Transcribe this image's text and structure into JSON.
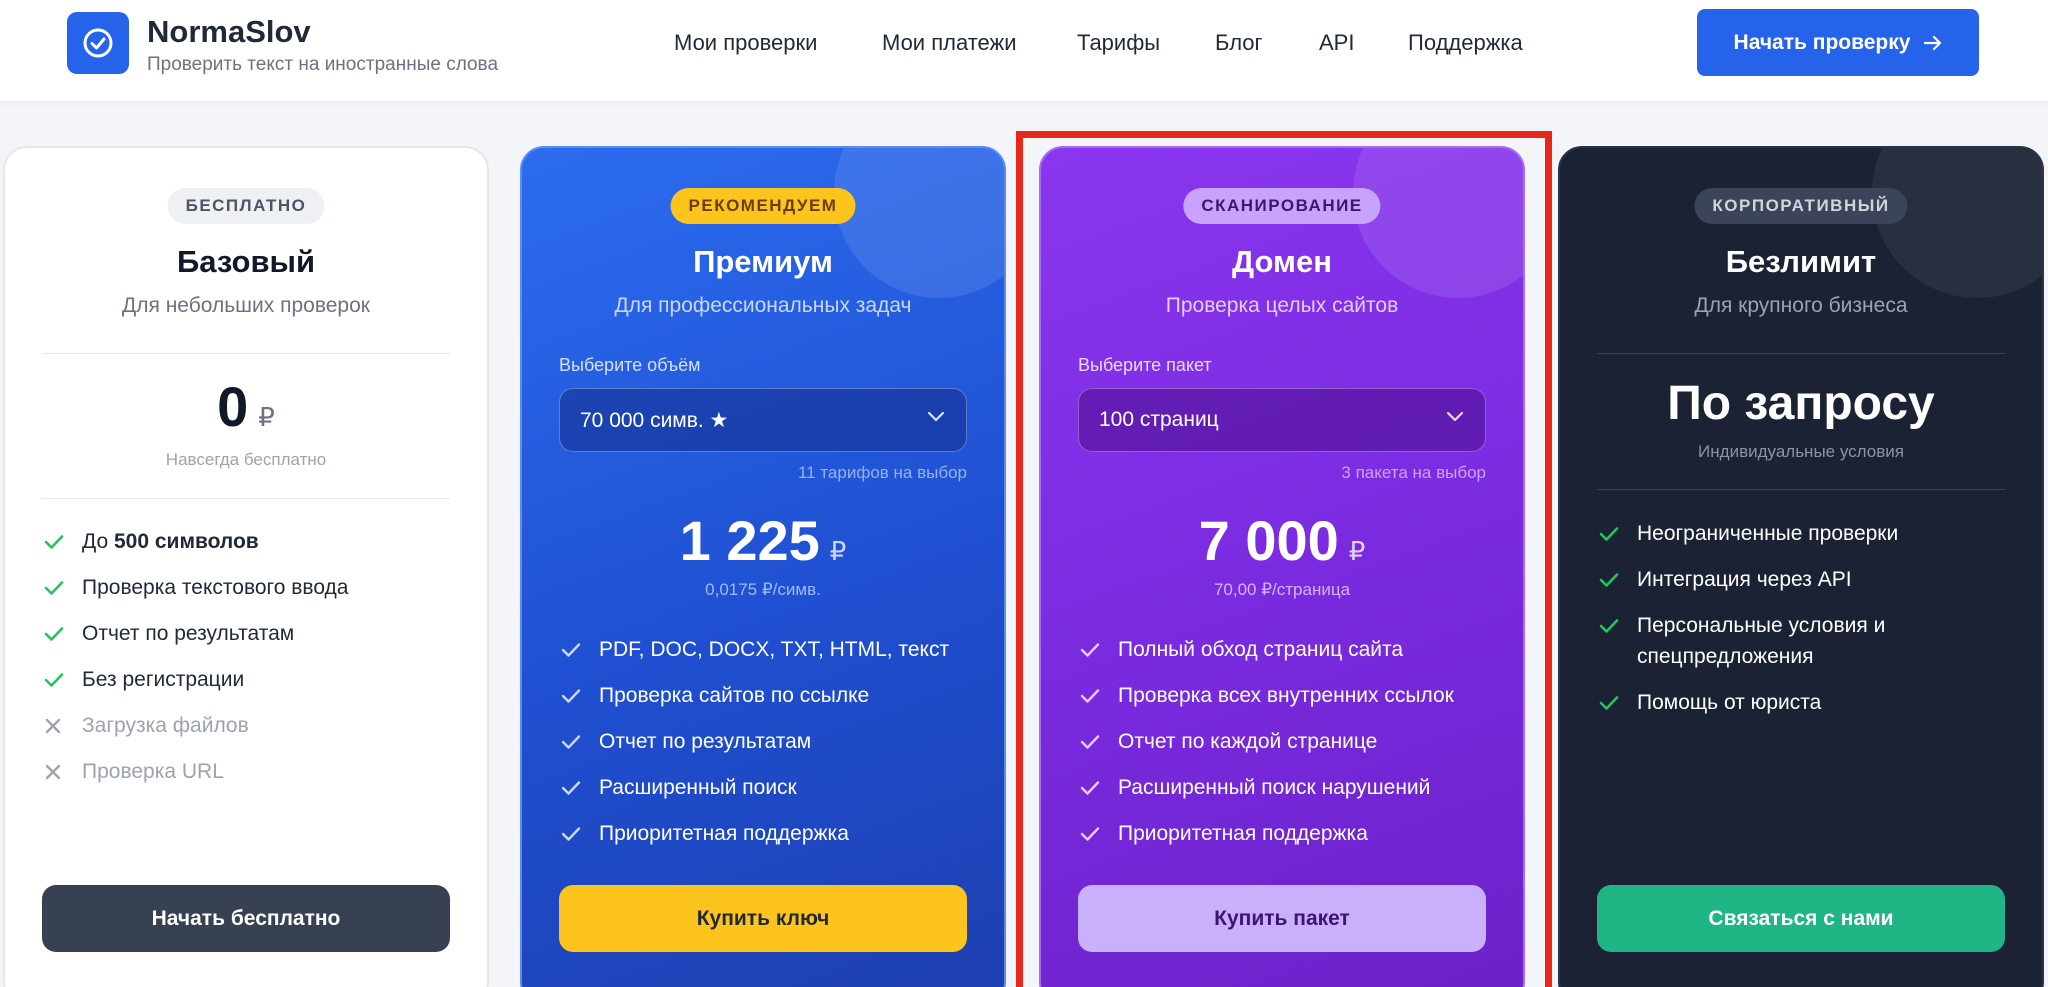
{
  "header": {
    "brand": "NormaSlov",
    "tagline": "Проверить текст на иностранные слова",
    "nav": [
      "Мои проверки",
      "Мои платежи",
      "Тарифы",
      "Блог",
      "API",
      "Поддержка"
    ],
    "cta_label": "Начать проверку"
  },
  "plans": {
    "basic": {
      "badge": "БЕСПЛАТНО",
      "title": "Базовый",
      "subtitle": "Для небольших проверок",
      "price": "0",
      "currency": "₽",
      "price_note": "Навсегда бесплатно",
      "features": [
        {
          "prefix": "До ",
          "bold": "500 символов",
          "enabled": true
        },
        {
          "text": "Проверка текстового ввода",
          "enabled": true
        },
        {
          "text": "Отчет по результатам",
          "enabled": true
        },
        {
          "text": "Без регистрации",
          "enabled": true
        },
        {
          "text": "Загрузка файлов",
          "enabled": false
        },
        {
          "text": "Проверка URL",
          "enabled": false
        }
      ],
      "button": "Начать бесплатно"
    },
    "premium": {
      "badge": "РЕКОМЕНДУЕМ",
      "title": "Премиум",
      "subtitle": "Для профессиональных задач",
      "select_label": "Выберите объём",
      "select_value": "70 000 симв. ★",
      "select_hint": "11 тарифов на выбор",
      "price": "1 225",
      "currency": "₽",
      "price_note": "0,0175 ₽/симв.",
      "features": [
        "PDF, DOC, DOCX, TXT, HTML, текст",
        "Проверка сайтов по ссылке",
        "Отчет по результатам",
        "Расширенный поиск",
        "Приоритетная поддержка"
      ],
      "button": "Купить ключ"
    },
    "domain": {
      "badge": "СКАНИРОВАНИЕ",
      "title": "Домен",
      "subtitle": "Проверка целых сайтов",
      "select_label": "Выберите пакет",
      "select_value": "100 страниц",
      "select_hint": "3 пакета на выбор",
      "price": "7 000",
      "currency": "₽",
      "price_note": "70,00 ₽/страница",
      "features": [
        "Полный обход страниц сайта",
        "Проверка всех внутренних ссылок",
        "Отчет по каждой странице",
        "Расширенный поиск нарушений",
        "Приоритетная поддержка"
      ],
      "button": "Купить пакет"
    },
    "unlimited": {
      "badge": "КОРПОРАТИВНЫЙ",
      "title": "Безлимит",
      "subtitle": "Для крупного бизнеса",
      "price": "По запросу",
      "price_note": "Индивидуальные условия",
      "features": [
        "Неограниченные проверки",
        "Интеграция через API",
        "Персональные условия и спецпредложения",
        "Помощь от юриста"
      ],
      "button": "Связаться с нами"
    }
  },
  "colors": {
    "primary": "#2563eb",
    "premium_accent": "#fcc41c",
    "domain_accent": "#7a2be0",
    "enterprise_bg": "#1b2233",
    "check_green": "#22c55e",
    "highlight_border": "#e8261a"
  }
}
